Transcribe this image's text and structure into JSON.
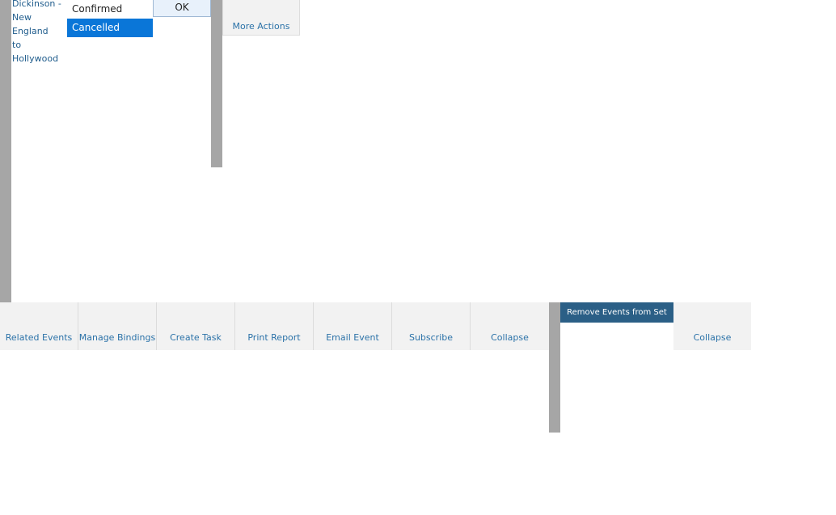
{
  "event": {
    "title": "Dickinson -\nNew England\nto Hollywood"
  },
  "status_list": {
    "options": [
      "Confirmed",
      "Cancelled"
    ],
    "selected": "Cancelled"
  },
  "ok_label": "OK",
  "more_actions_label": "More Actions",
  "toolbar": {
    "items": [
      "Related Events",
      "Manage Bindings",
      "Create Task",
      "Print Report",
      "Email Event",
      "Subscribe",
      "Collapse"
    ]
  },
  "set_panel": {
    "remove_label": "Remove Events from Set",
    "collapse_label": "Collapse"
  },
  "colors": {
    "link": "#2b72a8",
    "selected_option": "#0a76d8",
    "remove_button": "#2b5f86",
    "toolbar_bg": "#f2f2f2",
    "scrollbar": "#a6a6a6"
  }
}
